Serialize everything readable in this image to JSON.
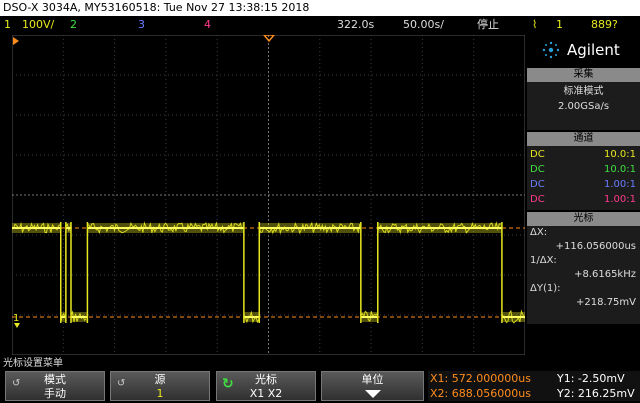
{
  "title": "DSO-X 3034A, MY53160518: Tue Nov 27 13:38:15 2018",
  "status": {
    "ch1_num": "1",
    "ch1_scale": "100V/",
    "ch2_num": "2",
    "ch3_num": "3",
    "ch4_num": "4",
    "timebase": "322.0s",
    "delay": "50.00s/",
    "run_state": "停止",
    "trig_source": "1",
    "trig_level": "889?"
  },
  "brand": {
    "name": "Agilent"
  },
  "acquire": {
    "header": "采集",
    "mode": "标准模式",
    "rate": "2.00GSa/s"
  },
  "channels": {
    "header": "通道",
    "rows": [
      {
        "coupling": "DC",
        "probe": "10.0:1",
        "color": "#e8e820"
      },
      {
        "coupling": "DC",
        "probe": "10.0:1",
        "color": "#40e040"
      },
      {
        "coupling": "DC",
        "probe": "1.00:1",
        "color": "#6a7cff"
      },
      {
        "coupling": "DC",
        "probe": "1.00:1",
        "color": "#ff3a8a"
      }
    ]
  },
  "cursors": {
    "header": "光标",
    "dx_label": "ΔX:",
    "dx_value": "+116.056000us",
    "inv_label": "1/ΔX:",
    "inv_value": "+8.6165kHz",
    "dy_label": "ΔY(1):",
    "dy_value": "+218.75mV"
  },
  "softkeys": {
    "menu_title": "光标设置菜单",
    "mode_label": "模式",
    "mode_value": "手动",
    "source_label": "源",
    "source_value": "1",
    "cursor_label": "光标",
    "cursor_value": "X1 X2",
    "units_label": "单位"
  },
  "readouts": {
    "x1": "X1: 572.000000us",
    "x2": "X2: 688.056000us",
    "y1": "Y1: -2.50mV",
    "y2": "Y2: 216.25mV"
  },
  "colors": {
    "ch1": "#e8e820",
    "ch2": "#40e040",
    "ch3": "#6a7cff",
    "ch4": "#ff3a8a",
    "cursor": "#ff8c1a",
    "accent": "#2a9fd8"
  },
  "waveform": {
    "channel": "1",
    "levels": [
      "high",
      "low"
    ],
    "transitions": [
      {
        "t": 0.095,
        "to": "low"
      },
      {
        "t": 0.105,
        "to": "high"
      },
      {
        "t": 0.115,
        "to": "low"
      },
      {
        "t": 0.147,
        "to": "high"
      },
      {
        "t": 0.452,
        "to": "low"
      },
      {
        "t": 0.482,
        "to": "high"
      },
      {
        "t": 0.68,
        "to": "low"
      },
      {
        "t": 0.713,
        "to": "high"
      },
      {
        "t": 0.955,
        "to": "low"
      }
    ]
  }
}
